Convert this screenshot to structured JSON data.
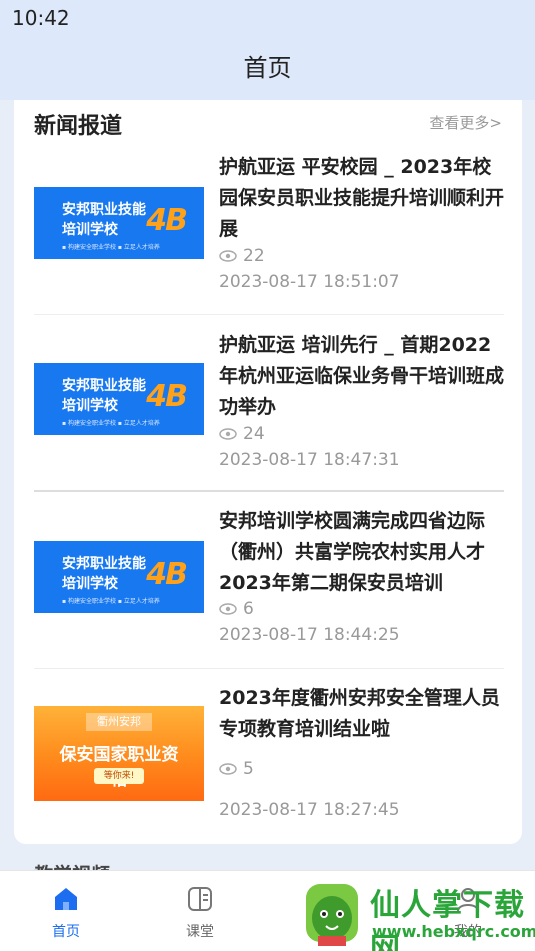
{
  "status_bar": {
    "time": "10:42"
  },
  "app_bar": {
    "title": "首页"
  },
  "news_section": {
    "heading": "新闻报道",
    "more_label": "查看更多>",
    "items": [
      {
        "title": "护航亚运 平安校园 _ 2023年校园保安员职业技能提升培训顺利开展",
        "views": "22",
        "date": "2023-08-17 18:51:07",
        "thumb": {
          "style": "blue",
          "line1": "安邦职业技能",
          "line2": "培训学校",
          "mark": "4B",
          "small": "▪ 构建安全职业学校   ▪ 立足人才培养"
        }
      },
      {
        "title": "护航亚运 培训先行 _ 首期2022年杭州亚运临保业务骨干培训班成功举办",
        "views": "24",
        "date": "2023-08-17 18:47:31",
        "thumb": {
          "style": "blue",
          "line1": "安邦职业技能",
          "line2": "培训学校",
          "mark": "4B",
          "small": "▪ 构建安全职业学校   ▪ 立足人才培养"
        }
      },
      {
        "title": "安邦培训学校圆满完成四省边际（衢州）共富学院农村实用人才2023年第二期保安员培训",
        "views": "6",
        "date": "2023-08-17 18:44:25",
        "thumb": {
          "style": "blue",
          "line1": "安邦职业技能",
          "line2": "培训学校",
          "mark": "4B",
          "small": "▪ 构建安全职业学校   ▪ 立足人才培养"
        }
      },
      {
        "title": "2023年度衢州安邦安全管理人员专项教育培训结业啦",
        "views": "5",
        "date": "2023-08-17 18:27:45",
        "thumb": {
          "style": "orange",
          "tag": "衢州安邦",
          "big": "保安国家职业资格",
          "pill": "等你来!"
        }
      }
    ]
  },
  "next_section": {
    "heading": "教学视频"
  },
  "tab_bar": {
    "tabs": [
      {
        "label": "首页",
        "icon": "home-icon",
        "active": true
      },
      {
        "label": "课堂",
        "icon": "book-icon",
        "active": false
      },
      {
        "label": "",
        "icon": "download-icon",
        "active": false
      },
      {
        "label": "我的",
        "icon": "user-icon",
        "active": false
      }
    ]
  },
  "watermark": {
    "text": "仙人掌下载网",
    "url": "www.hebxqrc.com",
    "icon": "cactus-icon"
  },
  "colors": {
    "accent": "#1c6df0",
    "app_bar_bg": "#dde8fa",
    "watermark": "#2aa53a"
  }
}
